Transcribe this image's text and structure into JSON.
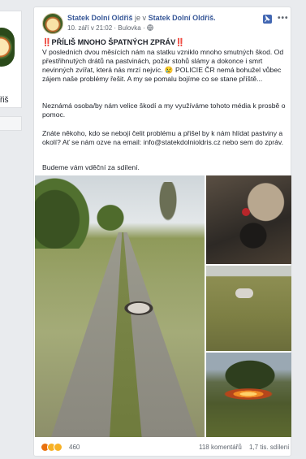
{
  "sidebar": {
    "name_fragment": "řiš"
  },
  "post": {
    "author": "Statek Dolní Oldřiš",
    "header_mid": "je v",
    "location": "Statek Dolní Oldřiš.",
    "date": "10. září v 21:02",
    "separator": "·",
    "place": "Bulovka",
    "separator2": "·",
    "privacy_icon": "globe-icon",
    "title_emoji_left": "‼️",
    "title": "PŘÍLIŠ MNOHO ŠPATNÝCH ZPRÁV",
    "title_emoji_right": "‼️",
    "paragraph1": "V posledních dvou měsících nám na statku vzniklo mnoho smutných škod. Od přestřihnutých drátů na pastvinách, požár stohů slámy a dokonce i smrt nevinných zvířat, která nás mrzí nejvíc. 😢 POLICIE ČR nemá bohužel vůbec zájem naše problémy řešit. A my se pomalu bojíme co se stane příště...",
    "paragraph2": "Neznámá osoba/by nám velice škodí a my využíváme tohoto média k prosbě o pomoc.",
    "paragraph3": "Znáte někoho, kdo se nebojí čelit problému a přišel by k nám hlídat pastviny a okolí? Ať se nám ozve na email: info@statekdolnioldris.cz nebo sem do zpráv.",
    "paragraph4": "Budeme vám vděční za sdílení.",
    "reactions_count": "460",
    "comments": "118 komentářů",
    "shares": "1,7 tis. sdílení"
  },
  "colors": {
    "link": "#385898",
    "alert": "#d12a2a",
    "muted": "#606770"
  }
}
